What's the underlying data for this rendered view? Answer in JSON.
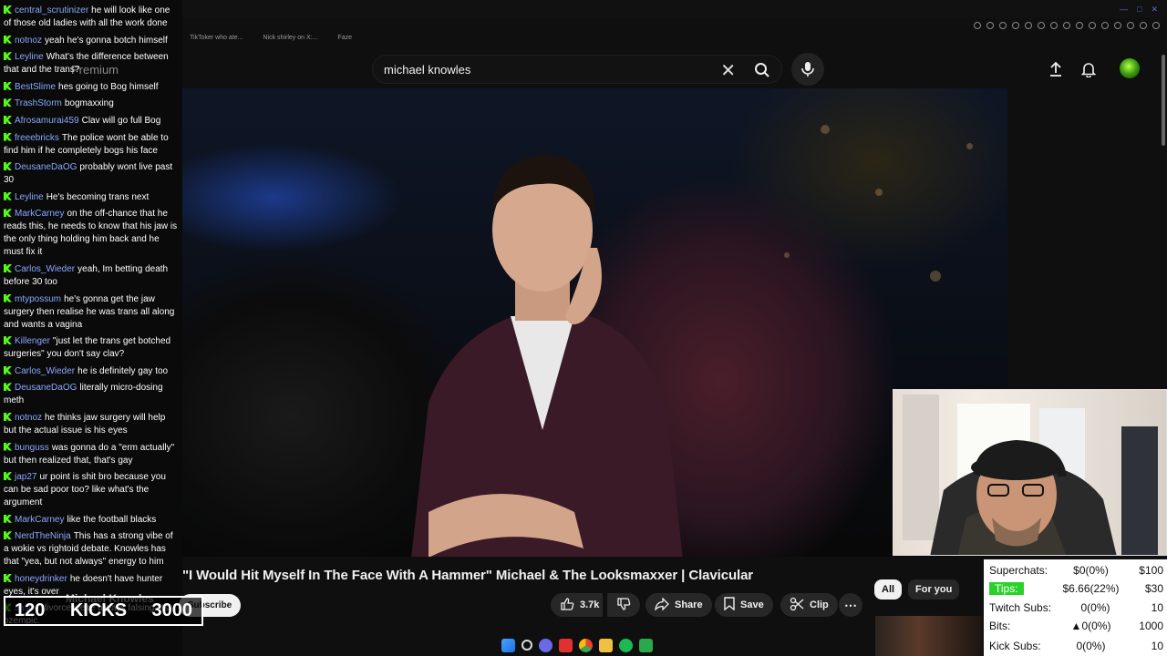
{
  "browser": {
    "tabs": [
      "TikToker who ate...",
      "Nick shirley on X:...",
      "Faze"
    ]
  },
  "search": {
    "query": "michael knowles"
  },
  "chat": {
    "overlay_label": "Premium",
    "messages": [
      {
        "user": "central_scrutinizer",
        "text": "he will look like one of those old ladies with all the work done"
      },
      {
        "user": "notnoz",
        "text": "yeah he's gonna botch himself"
      },
      {
        "user": "Leyline",
        "text": "What's the difference between that and the trans?"
      },
      {
        "user": "BestSlime",
        "text": "hes going to Bog himself"
      },
      {
        "user": "TrashStorm",
        "text": "bogmaxxing"
      },
      {
        "user": "Afrosamurai459",
        "text": "Clav will go full Bog"
      },
      {
        "user": "freeebricks",
        "text": "The police wont be able to find him if he completely bogs his face"
      },
      {
        "user": "DeusaneDaOG",
        "text": "probably wont live past 30"
      },
      {
        "user": "Leyline",
        "text": "He's becoming trans next"
      },
      {
        "user": "MarkCarney",
        "text": "on the off-chance that he reads this, he needs to know that his jaw is the only thing holding him back and he must fix it"
      },
      {
        "user": "Carlos_Wieder",
        "text": "yeah, Im betting death before 30 too"
      },
      {
        "user": "mtypossum",
        "text": "he's gonna get the jaw surgery then realise he was trans all along and wants a vagina"
      },
      {
        "user": "Killenger",
        "text": "\"just let the trans get botched surgeries\" you don't say clav?"
      },
      {
        "user": "Carlos_Wieder",
        "text": "he is definitely gay too"
      },
      {
        "user": "DeusaneDaOG",
        "text": "literally micro-dosing meth"
      },
      {
        "user": "notnoz",
        "text": "he thinks jaw surgery will help but the actual issue is his eyes"
      },
      {
        "user": "bunguss",
        "text": "was gonna do a \"erm actually\" but then realized that, that's gay"
      },
      {
        "user": "jap27",
        "text": "ur point is shit bro because you can be sad poor too? like what's the argument"
      },
      {
        "user": "MarkCarney",
        "text": "like the football blacks"
      },
      {
        "user": "NerdTheNinja",
        "text": "This has a strong vibe of a wokie vs rightoid debate. Knowles has that \"yea, but not always\" energy to him"
      },
      {
        "user": "honeydrinker",
        "text": "he doesn't have hunter eyes, it's over"
      },
      {
        "user": "Jason",
        "text": "divorce we're always falsing. its ozempic."
      }
    ]
  },
  "video": {
    "title": "\"I Would Hit Myself In The Face With A Hammer\" Michael & The Looksmaxxer | Clavicular",
    "channel": "Michael Knowles",
    "subscribe_label": "Subscribe",
    "likes": "3.7k",
    "share_label": "Share",
    "save_label": "Save",
    "clip_label": "Clip"
  },
  "filters": {
    "all_label": "All",
    "for_you_label": "For you"
  },
  "kicks": {
    "current": "120",
    "label": "KICKS",
    "goal": "3000"
  },
  "stats": {
    "superchats": {
      "label": "Superchats:",
      "value": "$0(0%)",
      "goal": "$100"
    },
    "tips": {
      "label": "Tips:",
      "value": "$6.66(22%)",
      "goal": "$30"
    },
    "twitch_subs": {
      "label": "Twitch Subs:",
      "value": "0(0%)",
      "goal": "10"
    },
    "bits": {
      "label": "Bits:",
      "value": "0(0%)",
      "goal": "1000"
    },
    "kick_subs": {
      "label": "Kick Subs:",
      "value": "0(0%)",
      "goal": "10"
    }
  },
  "colors": {
    "kick_green": "#53fc18",
    "chat_username": "#8aa8ff",
    "tips_green": "#2bd12b"
  }
}
